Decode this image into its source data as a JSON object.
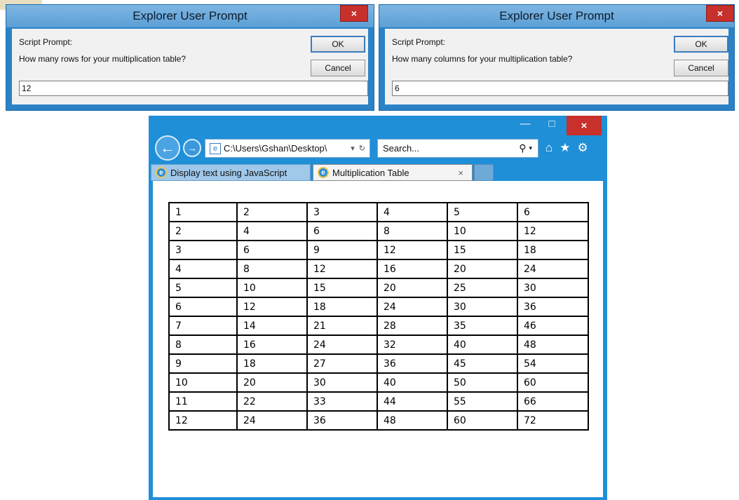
{
  "dialog_rows": {
    "title": "Explorer User Prompt",
    "close": "×",
    "prompt_label": "Script Prompt:",
    "question": "How many rows for your multiplication table?",
    "ok_label": "OK",
    "cancel_label": "Cancel",
    "input_value": "12"
  },
  "dialog_cols": {
    "title": "Explorer User Prompt",
    "close": "×",
    "prompt_label": "Script Prompt:",
    "question": "How many columns for your multiplication table?",
    "ok_label": "OK",
    "cancel_label": "Cancel",
    "input_value": "6"
  },
  "browser": {
    "window_controls": {
      "minimize": "—",
      "maximize": "□",
      "close": "×"
    },
    "nav": {
      "back": "←",
      "forward": "→"
    },
    "address": {
      "page_icon": "e",
      "url": "C:\\Users\\Gshan\\Desktop\\",
      "dropdown_icon": "▾",
      "refresh_icon": "↻"
    },
    "search": {
      "placeholder": "Search...",
      "search_icon": "⚲",
      "dropdown_icon": "▾"
    },
    "toolbar": {
      "home_icon": "⌂",
      "favorites_icon": "★",
      "settings_icon": "⚙"
    },
    "tabs": [
      {
        "label": "Display text using JavaScript",
        "active": false,
        "icon": "e"
      },
      {
        "label": "Multiplication Table",
        "active": true,
        "icon": "e",
        "close": "×"
      }
    ]
  },
  "table": {
    "rows": [
      [
        "1",
        "2",
        "3",
        "4",
        "5",
        "6"
      ],
      [
        "2",
        "4",
        "6",
        "8",
        "10",
        "12"
      ],
      [
        "3",
        "6",
        "9",
        "12",
        "15",
        "18"
      ],
      [
        "4",
        "8",
        "12",
        "16",
        "20",
        "24"
      ],
      [
        "5",
        "10",
        "15",
        "20",
        "25",
        "30"
      ],
      [
        "6",
        "12",
        "18",
        "24",
        "30",
        "36"
      ],
      [
        "7",
        "14",
        "21",
        "28",
        "35",
        "46"
      ],
      [
        "8",
        "16",
        "24",
        "32",
        "40",
        "48"
      ],
      [
        "9",
        "18",
        "27",
        "36",
        "45",
        "54"
      ],
      [
        "10",
        "20",
        "30",
        "40",
        "50",
        "60"
      ],
      [
        "11",
        "22",
        "33",
        "44",
        "55",
        "66"
      ],
      [
        "12",
        "24",
        "36",
        "48",
        "60",
        "72"
      ]
    ]
  },
  "colors": {
    "window_blue": "#1f8fd8",
    "close_red": "#c7302b",
    "dialog_body": "#f1f1f1"
  }
}
